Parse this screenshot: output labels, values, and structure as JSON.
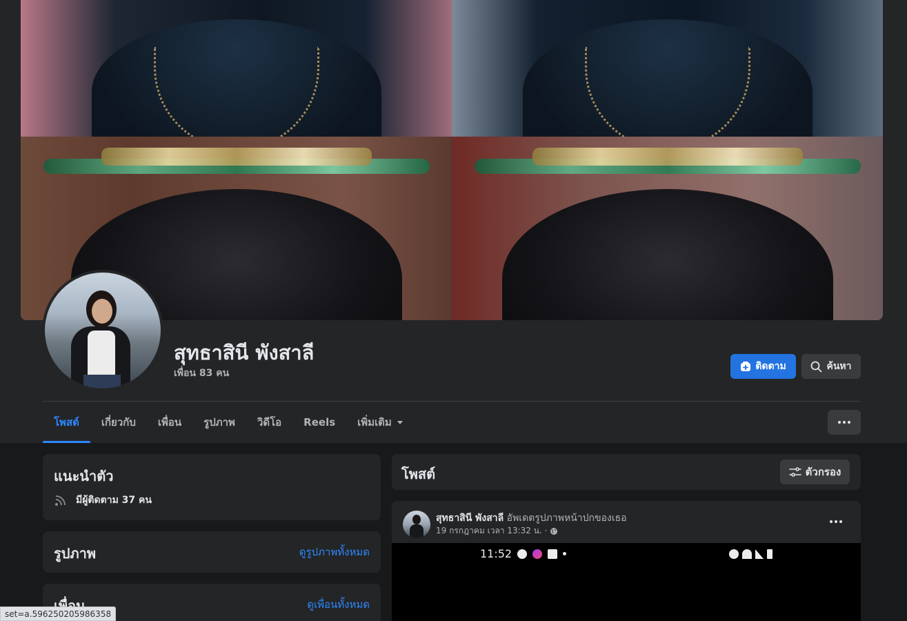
{
  "profile": {
    "name": "สุทธาสินี พังสาลี",
    "friend_count": "เพื่อน 83 คน"
  },
  "actions": {
    "follow_label": "ติดตาม",
    "search_label": "ค้นหา"
  },
  "tabs": [
    {
      "label": "โพสต์",
      "active": true
    },
    {
      "label": "เกี่ยวกับ"
    },
    {
      "label": "เพื่อน"
    },
    {
      "label": "รูปภาพ"
    },
    {
      "label": "วิดีโอ"
    },
    {
      "label": "Reels"
    },
    {
      "label": "เพิ่มเติม"
    }
  ],
  "intro": {
    "title": "แนะนำตัว",
    "followers": "มีผู้ติดตาม 37 คน"
  },
  "photos": {
    "title": "รูปภาพ",
    "see_all": "ดูรูปภาพทั้งหมด"
  },
  "friends": {
    "title": "เพื่อน",
    "see_all": "ดูเพื่อนทั้งหมด"
  },
  "posts": {
    "title": "โพสต์",
    "filter_label": "ตัวกรอง"
  },
  "post": {
    "author": "สุทธาสินี พังสาลี",
    "action": "อัพเดตรูปภาพหน้าปกของเธอ",
    "timestamp": "19 กรกฎาคม เวลา 13:32 น. ·",
    "image_status_time": "11:52"
  },
  "url_tooltip": "set=a.596250205986358",
  "colors": {
    "background": "#18191a",
    "surface": "#242526",
    "accent": "#2374e1",
    "link": "#2d88ff"
  },
  "icons": [
    "follow-icon",
    "search-icon",
    "caret-down-icon",
    "more-icon",
    "rss-icon",
    "filter-icon",
    "globe-icon"
  ]
}
